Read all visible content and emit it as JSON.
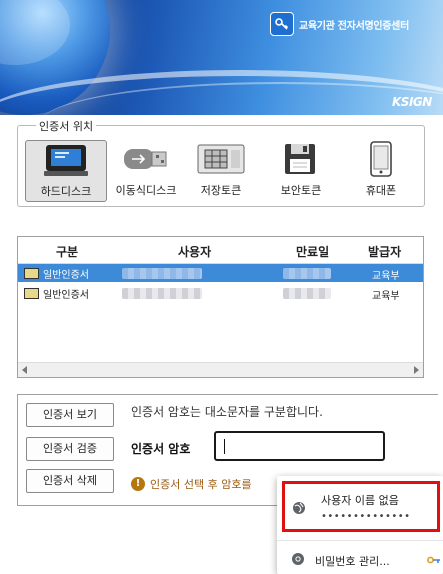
{
  "banner": {
    "brand_text": "교육기관 전자서명인증센터",
    "ksign_logo": "KSIGN",
    "logo_icon": "certificate-key-icon"
  },
  "location": {
    "legend": "인증서 위치",
    "items": [
      {
        "label": "하드디스크",
        "icon": "hard-disk-icon",
        "selected": true
      },
      {
        "label": "이동식디스크",
        "icon": "usb-drive-icon",
        "selected": false
      },
      {
        "label": "저장토큰",
        "icon": "storage-token-icon",
        "selected": false
      },
      {
        "label": "보안토큰",
        "icon": "security-token-icon",
        "selected": false
      },
      {
        "label": "휴대폰",
        "icon": "mobile-phone-icon",
        "selected": false
      }
    ]
  },
  "cert_table": {
    "columns": [
      "구분",
      "사용자",
      "만료일",
      "발급자"
    ],
    "rows": [
      {
        "type": "일반인증서",
        "issuer": "교육부",
        "selected": true
      },
      {
        "type": "일반인증서",
        "issuer": "교육부",
        "selected": false
      }
    ]
  },
  "actions": {
    "view": "인증서 보기",
    "verify": "인증서 검증",
    "delete": "인증서 삭제"
  },
  "password": {
    "case_note": "인증서 암호는 대소문자를 구분합니다.",
    "label": "인증서 암호",
    "value": "",
    "hint": "인증서 선택 후 암호를"
  },
  "autofill": {
    "username": "사용자 이름 없음",
    "masked_password": "••••••••••••••",
    "manage": "비밀번호 관리..."
  }
}
